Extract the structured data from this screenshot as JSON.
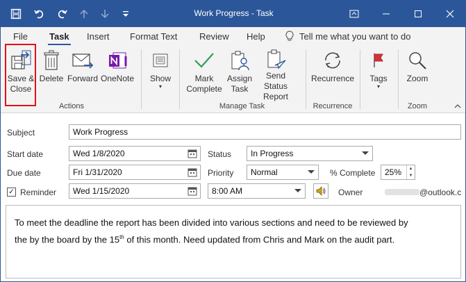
{
  "window": {
    "title": "Work Progress  -  Task"
  },
  "qat": {
    "save_icon": "save-icon",
    "undo_icon": "undo-icon",
    "redo_icon": "redo-icon",
    "up_icon": "up-arrow-icon",
    "down_icon": "down-arrow-icon",
    "more_icon": "customize-qat-icon"
  },
  "tabs": [
    {
      "label": "File"
    },
    {
      "label": "Task",
      "active": true
    },
    {
      "label": "Insert"
    },
    {
      "label": "Format Text"
    },
    {
      "label": "Review"
    },
    {
      "label": "Help"
    }
  ],
  "tell_me": "Tell me what you want to do",
  "ribbon": {
    "actions": {
      "label": "Actions",
      "save_close": "Save &\nClose",
      "delete": "Delete",
      "forward": "Forward",
      "onenote": "OneNote"
    },
    "show": {
      "label": "Show"
    },
    "manage": {
      "label": "Manage Task",
      "mark_complete": "Mark\nComplete",
      "assign_task": "Assign\nTask",
      "send_status": "Send Status\nReport"
    },
    "recurrence": {
      "label": "Recurrence",
      "button": "Recurrence"
    },
    "tags": {
      "label": "Tags"
    },
    "zoom": {
      "label": "Zoom",
      "button": "Zoom"
    }
  },
  "form": {
    "subject_label": "Subject",
    "subject_value": "Work Progress",
    "start_label": "Start date",
    "start_value": "Wed 1/8/2020",
    "due_label": "Due date",
    "due_value": "Fri 1/31/2020",
    "reminder_label": "Reminder",
    "reminder_checked": true,
    "reminder_date": "Wed 1/15/2020",
    "reminder_time": "8:00 AM",
    "status_label": "Status",
    "status_value": "In Progress",
    "priority_label": "Priority",
    "priority_value": "Normal",
    "complete_label": "% Complete",
    "complete_value": "25%",
    "owner_label": "Owner",
    "owner_value": "@outlook.c"
  },
  "body_text": {
    "line1": "To meet the deadline the report has been divided into various sections and need to be reviewed by",
    "line2a": "the by the board by the 15",
    "sup": "th",
    "line2b": " of this month. Need updated from Chris and Mark on the audit part."
  },
  "colors": {
    "title_bar": "#2b579a",
    "ribbon": "#f3f3f3",
    "highlight": "#e0101a",
    "accent_green": "#2e9e57",
    "onenote": "#7719aa"
  }
}
